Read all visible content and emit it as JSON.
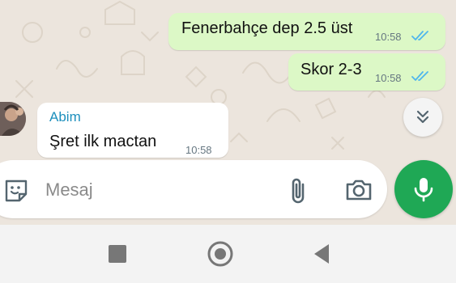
{
  "messages": [
    {
      "direction": "outgoing",
      "text": "Fenerbahçe dep 2.5 üst",
      "time": "10:58",
      "status": "read"
    },
    {
      "direction": "outgoing",
      "text": "Skor 2-3",
      "time": "10:58",
      "status": "read"
    },
    {
      "direction": "incoming",
      "sender": "Abim",
      "text": "Şret ilk mactan",
      "time": "10:58"
    }
  ],
  "composer": {
    "placeholder": "Mesaj"
  },
  "icons": {
    "sticker": "sticker-icon",
    "attach": "paperclip-icon",
    "camera": "camera-icon",
    "mic": "microphone-icon",
    "scroll": "double-chevron-down-icon",
    "nav_recent": "square-icon",
    "nav_home": "circle-icon",
    "nav_back": "triangle-back-icon"
  },
  "colors": {
    "outgoing_bubble": "#dcf8c6",
    "incoming_bubble": "#ffffff",
    "sender_name": "#1d8fbd",
    "read_ticks": "#4fb6ec",
    "mic_button": "#1fa855",
    "chat_background": "#ece5dd"
  }
}
